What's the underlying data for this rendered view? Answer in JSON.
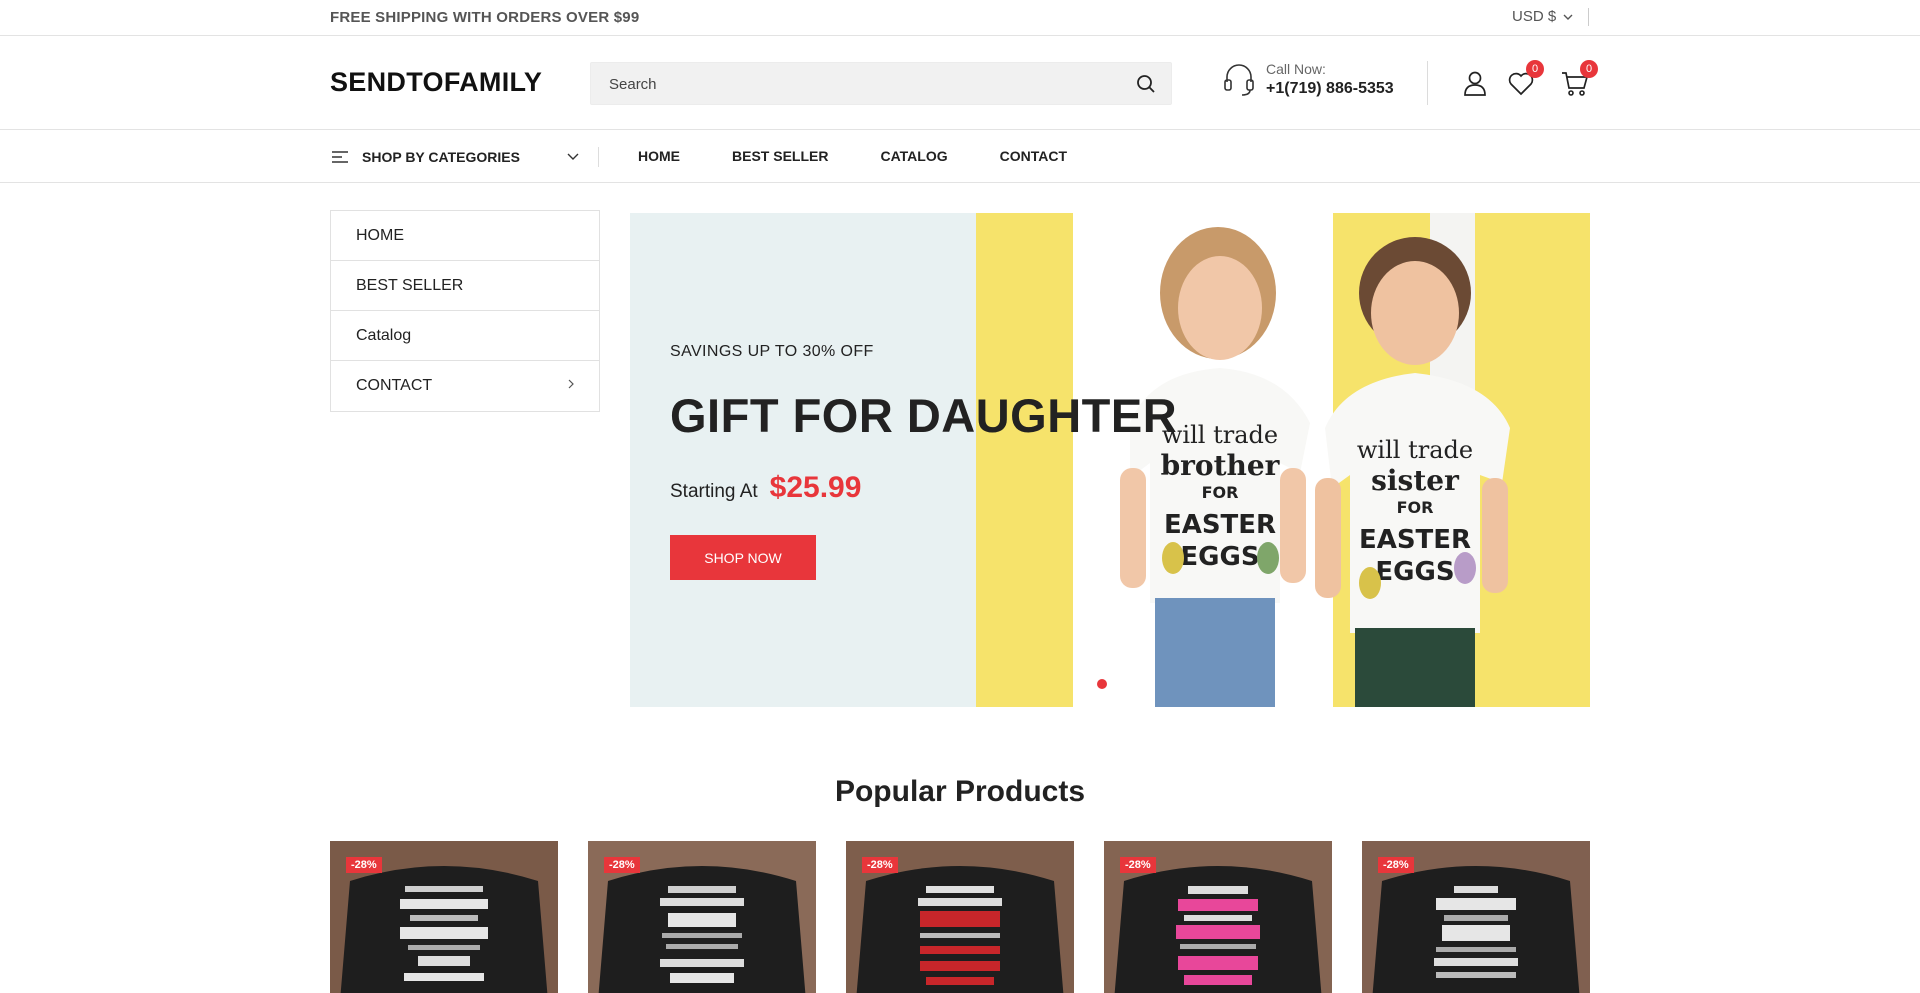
{
  "topbar": {
    "promo": "FREE SHIPPING WITH ORDERS OVER $99",
    "currency": "USD $"
  },
  "header": {
    "logo": "SENDTOFAMILY",
    "search_placeholder": "Search",
    "call_label": "Call Now:",
    "phone": "+1(719) 886-5353",
    "wishlist_count": "0",
    "cart_count": "0"
  },
  "nav": {
    "categories_label": "SHOP BY CATEGORIES",
    "links": [
      "HOME",
      "BEST SELLER",
      "CATALOG",
      "CONTACT"
    ]
  },
  "sidemenu": {
    "items": [
      "HOME",
      "BEST SELLER",
      "Catalog",
      "CONTACT"
    ]
  },
  "hero": {
    "savings": "SAVINGS UP TO 30% OFF",
    "title": "GIFT FOR DAUGHTER",
    "starting_label": "Starting At",
    "price": "$25.99",
    "button": "SHOP NOW",
    "slide_active": 1,
    "slide_count": 2,
    "accent_color": "#e8363b"
  },
  "popular": {
    "title": "Popular Products",
    "products": [
      {
        "discount": "-28%"
      },
      {
        "discount": "-28%"
      },
      {
        "discount": "-28%"
      },
      {
        "discount": "-28%"
      },
      {
        "discount": "-28%"
      }
    ]
  }
}
